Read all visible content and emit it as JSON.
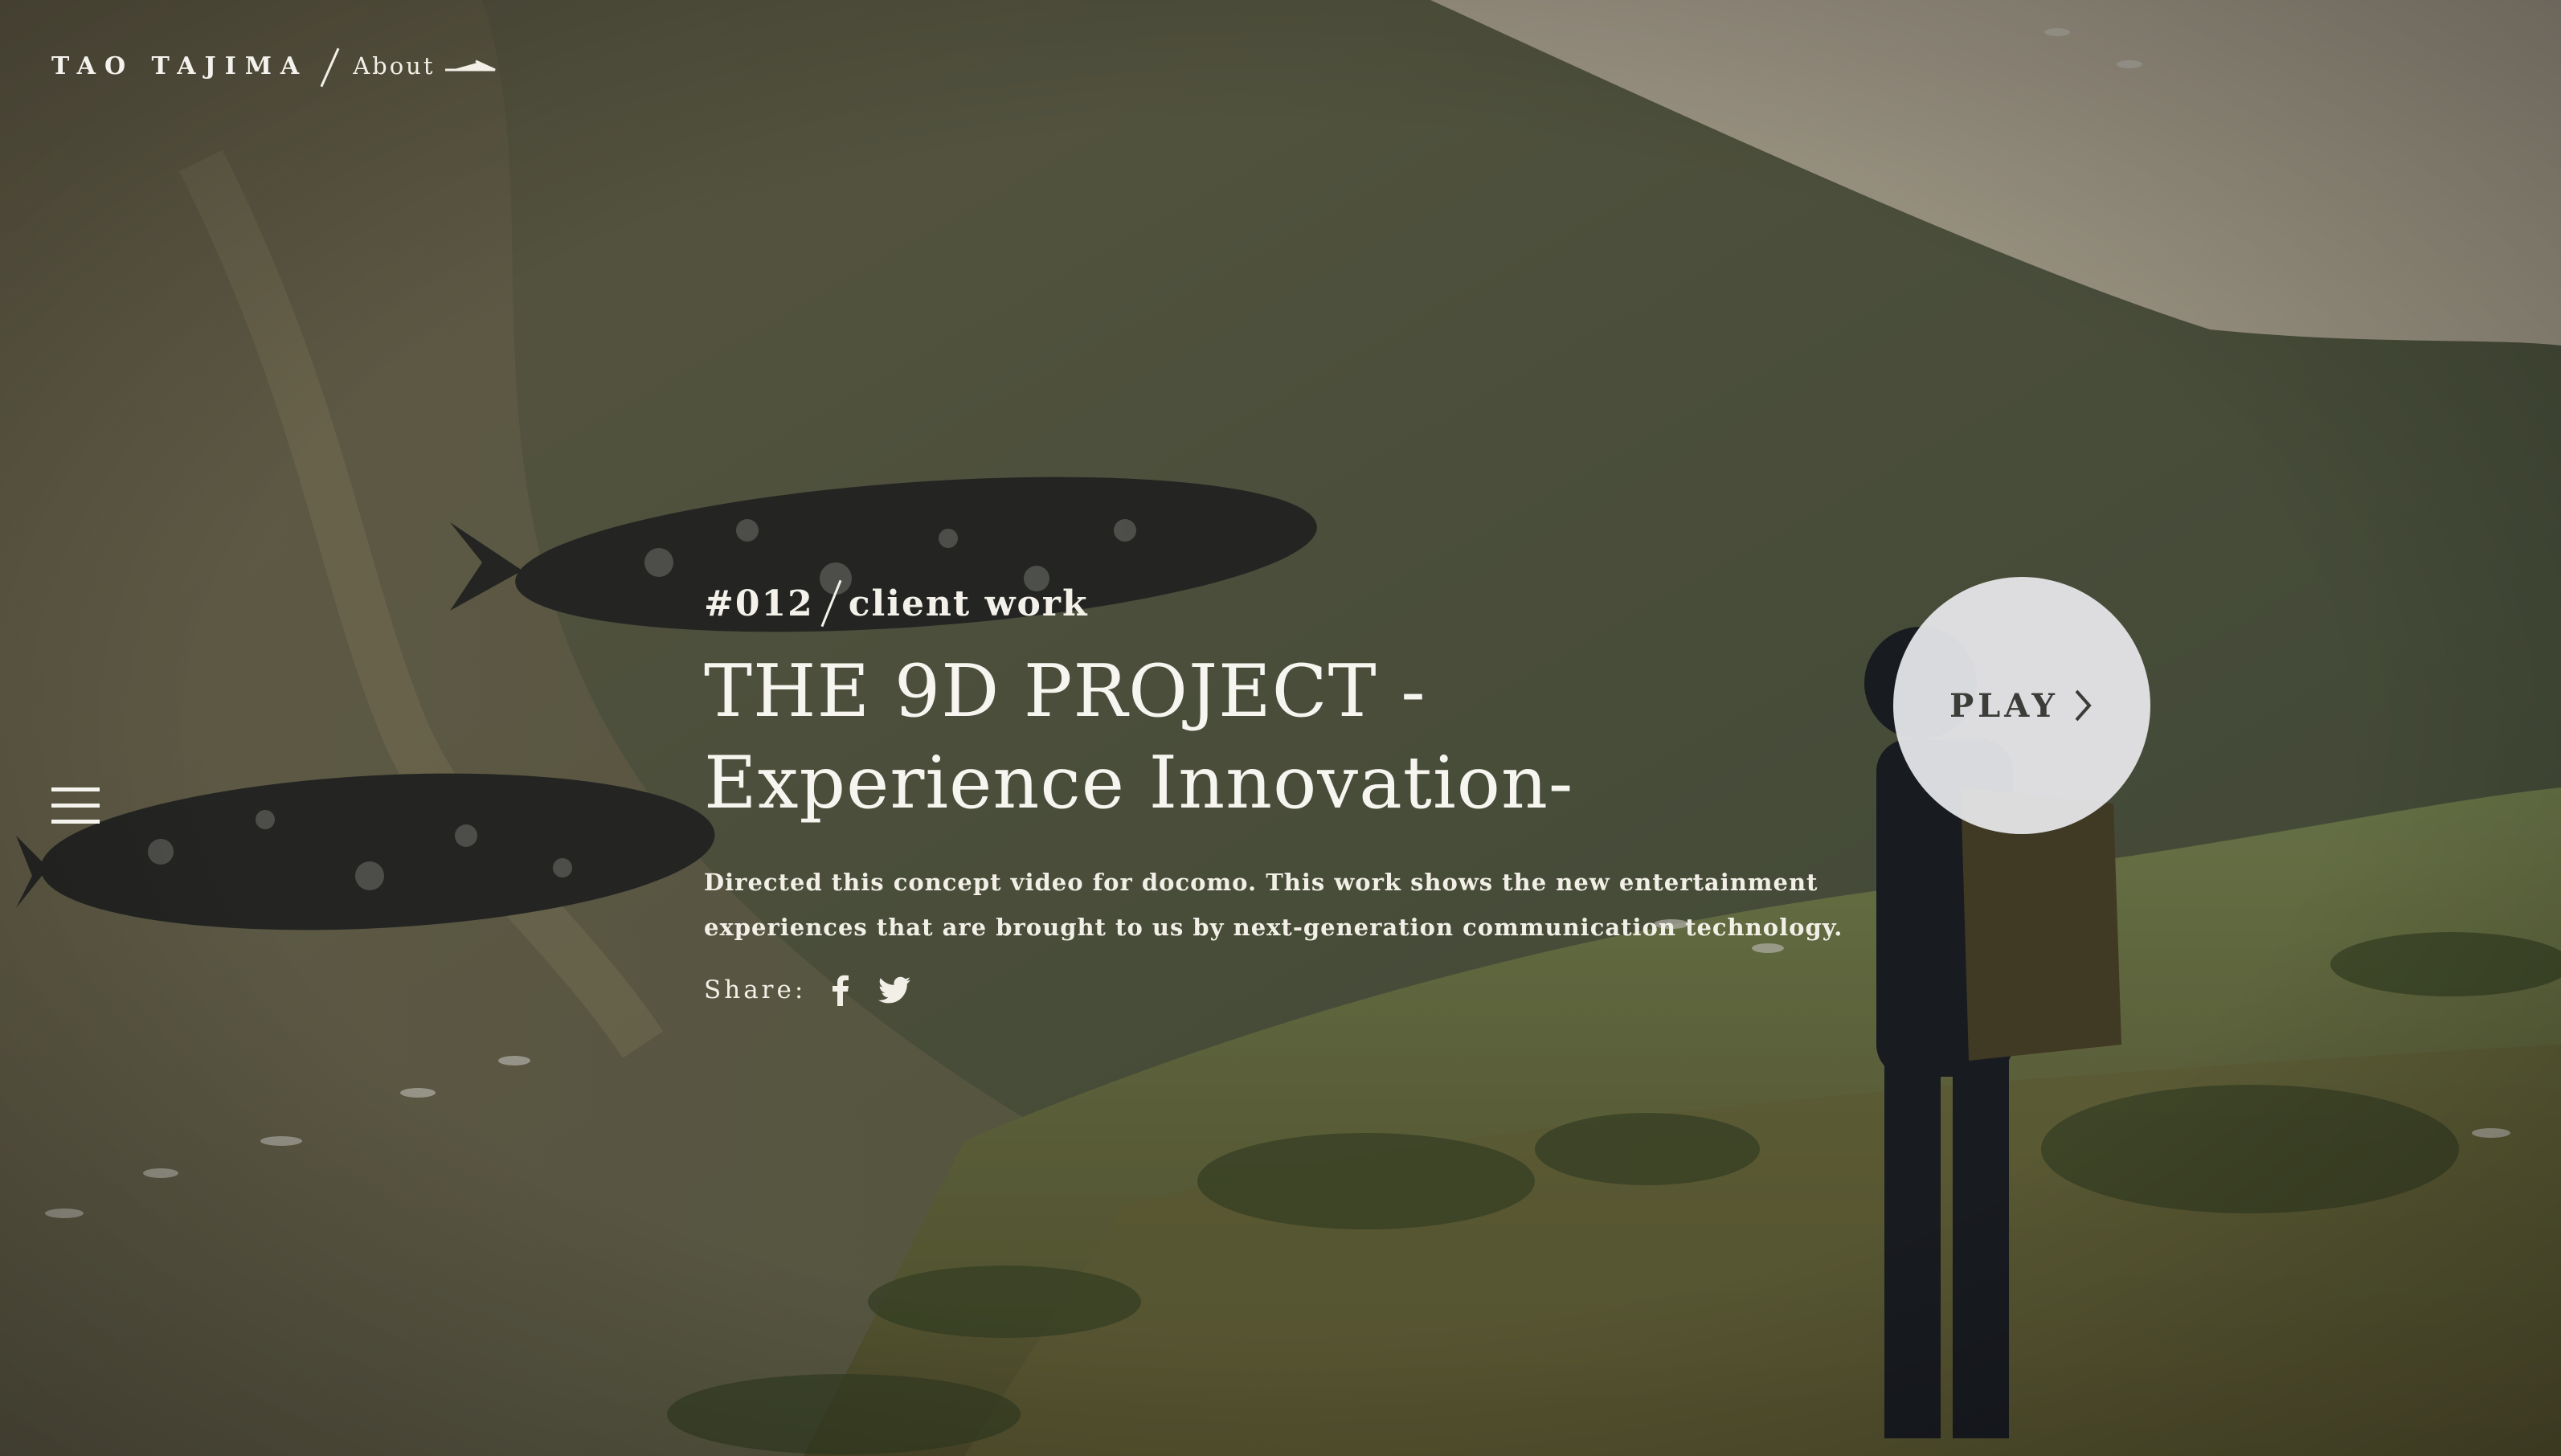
{
  "header": {
    "brand": "TAO TAJIMA",
    "about_label": "About",
    "icons": {
      "about": "arrow-right-icon",
      "menu": "hamburger-menu-icon"
    }
  },
  "work": {
    "number": "#012",
    "category": "client work",
    "title": "THE 9D PROJECT -Experience Innovation-",
    "description": "Directed this concept video for docomo. This work shows the new entertainment experiences that are brought to us by next-generation communication technology.",
    "share_label": "Share:",
    "share_icons": [
      "facebook-icon",
      "twitter-icon"
    ]
  },
  "play": {
    "label": "PLAY",
    "icon": "chevron-right-icon"
  },
  "colors": {
    "text": "#ffffff",
    "play_button_bg": "#e8e8ec",
    "play_text": "#3b3d39"
  }
}
